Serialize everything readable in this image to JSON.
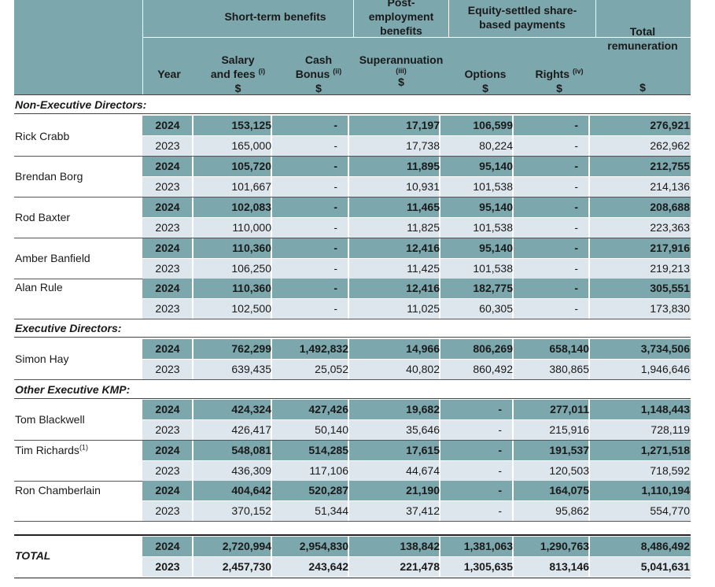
{
  "header": {
    "short_term": "Short-term benefits",
    "post_employment": [
      "Post-",
      "employment",
      "benefits"
    ],
    "equity": [
      "Equity-settled share-",
      "based payments"
    ],
    "total": [
      "Total",
      "remuneration"
    ],
    "year": "Year",
    "salary": [
      "Salary",
      "and fees"
    ],
    "salary_note": "(i)",
    "cash": [
      "Cash",
      "Bonus"
    ],
    "cash_note": "(ii)",
    "superannuation": "Superannuation",
    "super_note": "(iii)",
    "options": "Options",
    "rights": "Rights",
    "rights_note": "(iv)",
    "currency": "$"
  },
  "sections": {
    "non_exec": "Non-Executive Directors:",
    "exec": "Executive Directors:",
    "kmp": "Other Executive KMP:"
  },
  "people": [
    {
      "name": "Rick Crabb",
      "note": "",
      "y24": {
        "year": "2024",
        "salary": "153,125",
        "cash": "-",
        "super": "17,197",
        "options": "106,599",
        "rights": "-",
        "total": "276,921"
      },
      "y23": {
        "year": "2023",
        "salary": "165,000",
        "cash": "-",
        "super": "17,738",
        "options": "80,224",
        "rights": "-",
        "total": "262,962"
      }
    },
    {
      "name": "Brendan Borg",
      "note": "",
      "y24": {
        "year": "2024",
        "salary": "105,720",
        "cash": "-",
        "super": "11,895",
        "options": "95,140",
        "rights": "-",
        "total": "212,755"
      },
      "y23": {
        "year": "2023",
        "salary": "101,667",
        "cash": "-",
        "super": "10,931",
        "options": "101,538",
        "rights": "-",
        "total": "214,136"
      }
    },
    {
      "name": "Rod Baxter",
      "note": "",
      "y24": {
        "year": "2024",
        "salary": "102,083",
        "cash": "-",
        "super": "11,465",
        "options": "95,140",
        "rights": "-",
        "total": "208,688"
      },
      "y23": {
        "year": "2023",
        "salary": "110,000",
        "cash": "-",
        "super": "11,825",
        "options": "101,538",
        "rights": "-",
        "total": "223,363"
      }
    },
    {
      "name": "Amber Banfield",
      "note": "",
      "y24": {
        "year": "2024",
        "salary": "110,360",
        "cash": "-",
        "super": "12,416",
        "options": "95,140",
        "rights": "-",
        "total": "217,916"
      },
      "y23": {
        "year": "2023",
        "salary": "106,250",
        "cash": "-",
        "super": "11,425",
        "options": "101,538",
        "rights": "-",
        "total": "219,213"
      }
    },
    {
      "name": "Alan Rule",
      "note": "",
      "y24": {
        "year": "2024",
        "salary": "110,360",
        "cash": "-",
        "super": "12,416",
        "options": "182,775",
        "rights": "-",
        "total": "305,551"
      },
      "y23": {
        "year": "2023",
        "salary": "102,500",
        "cash": "-",
        "super": "11,025",
        "options": "60,305",
        "rights": "-",
        "total": "173,830"
      }
    },
    {
      "name": "Simon Hay",
      "note": "",
      "y24": {
        "year": "2024",
        "salary": "762,299",
        "cash": "1,492,832",
        "super": "14,966",
        "options": "806,269",
        "rights": "658,140",
        "total": "3,734,506"
      },
      "y23": {
        "year": "2023",
        "salary": "639,435",
        "cash": "25,052",
        "super": "40,802",
        "options": "860,492",
        "rights": "380,865",
        "total": "1,946,646"
      }
    },
    {
      "name": "Tom Blackwell",
      "note": "",
      "y24": {
        "year": "2024",
        "salary": "424,324",
        "cash": "427,426",
        "super": "19,682",
        "options": "-",
        "rights": "277,011",
        "total": "1,148,443"
      },
      "y23": {
        "year": "2023",
        "salary": "426,417",
        "cash": "50,140",
        "super": "35,646",
        "options": "-",
        "rights": "215,916",
        "total": "728,119"
      }
    },
    {
      "name": "Tim Richards",
      "note": "(1)",
      "y24": {
        "year": "2024",
        "salary": "548,081",
        "cash": "514,285",
        "super": "17,615",
        "options": "-",
        "rights": "191,537",
        "total": "1,271,518"
      },
      "y23": {
        "year": "2023",
        "salary": "436,309",
        "cash": "117,106",
        "super": "44,674",
        "options": "-",
        "rights": "120,503",
        "total": "718,592"
      }
    },
    {
      "name": "Ron Chamberlain",
      "note": "",
      "y24": {
        "year": "2024",
        "salary": "404,642",
        "cash": "520,287",
        "super": "21,190",
        "options": "-",
        "rights": "164,075",
        "total": "1,110,194"
      },
      "y23": {
        "year": "2023",
        "salary": "370,152",
        "cash": "51,344",
        "super": "37,412",
        "options": "-",
        "rights": "95,862",
        "total": "554,770"
      }
    }
  ],
  "total": {
    "label": "TOTAL",
    "y24": {
      "year": "2024",
      "salary": "2,720,994",
      "cash": "2,954,830",
      "super": "138,842",
      "options": "1,381,063",
      "rights": "1,290,763",
      "total": "8,486,492"
    },
    "y23": {
      "year": "2023",
      "salary": "2,457,730",
      "cash": "243,642",
      "super": "221,478",
      "options": "1,305,635",
      "rights": "813,146",
      "total": "5,041,631"
    }
  },
  "colors": {
    "header": "#7ba7ad",
    "row_2024": "#7ba7ad",
    "row_2023": "#dde6ec"
  }
}
